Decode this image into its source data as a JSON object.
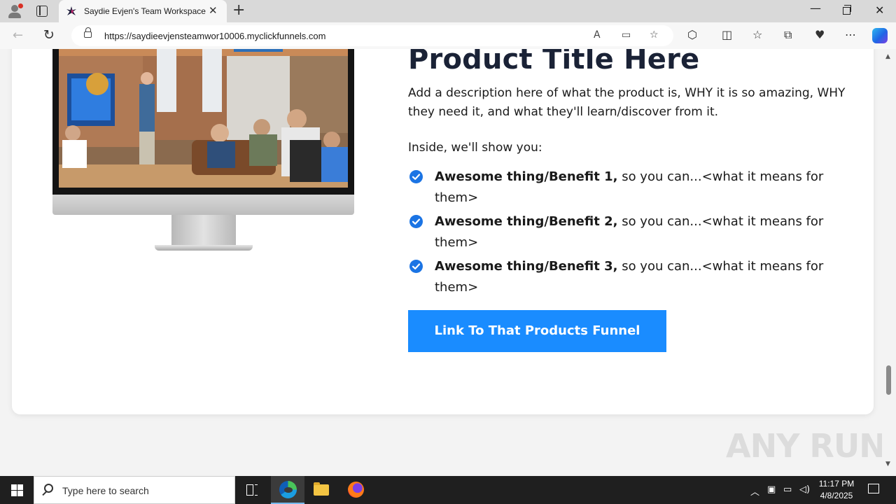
{
  "browser": {
    "tab_title": "Saydie Evjen's Team Workspace",
    "tab_close": "✕",
    "new_tab": "+",
    "url": "https://saydieevjensteamwor10006.myclickfunnels.com",
    "window_minimize": "—",
    "window_close": "✕"
  },
  "page": {
    "product_title": "Product Title Here",
    "description": "Add a description here of what the product is, WHY it is so amazing, WHY they need it, and what they'll learn/discover from it.",
    "inside_label": "Inside, we'll show you:",
    "benefits": [
      {
        "bold": "Awesome thing/Benefit 1,",
        "rest": " so you can...<what it means for them>"
      },
      {
        "bold": "Awesome thing/Benefit 2,",
        "rest": " so you can...<what it means for them>"
      },
      {
        "bold": "Awesome thing/Benefit 3,",
        "rest": " so you can...<what it means for them>"
      }
    ],
    "cta_label": "Link To That Products Funnel",
    "watermark": "ANY RUN"
  },
  "taskbar": {
    "search_placeholder": "Type here to search",
    "time": "11:17 PM",
    "date": "4/8/2025"
  },
  "colors": {
    "cta": "#1a8cff",
    "check": "#1b74e4",
    "title": "#1a2236"
  },
  "icons": [
    "profile-icon",
    "tab-actions-icon",
    "back-icon",
    "reload-icon",
    "lock-icon",
    "read-aloud-icon",
    "immersive-reader-icon",
    "favorite-icon",
    "extensions-icon",
    "split-screen-icon",
    "favorites-icon",
    "collections-icon",
    "performance-icon",
    "more-icon",
    "copilot-icon",
    "check-circle-icon",
    "windows-start-icon",
    "search-icon",
    "task-view-icon",
    "edge-icon",
    "file-explorer-icon",
    "firefox-icon"
  ]
}
